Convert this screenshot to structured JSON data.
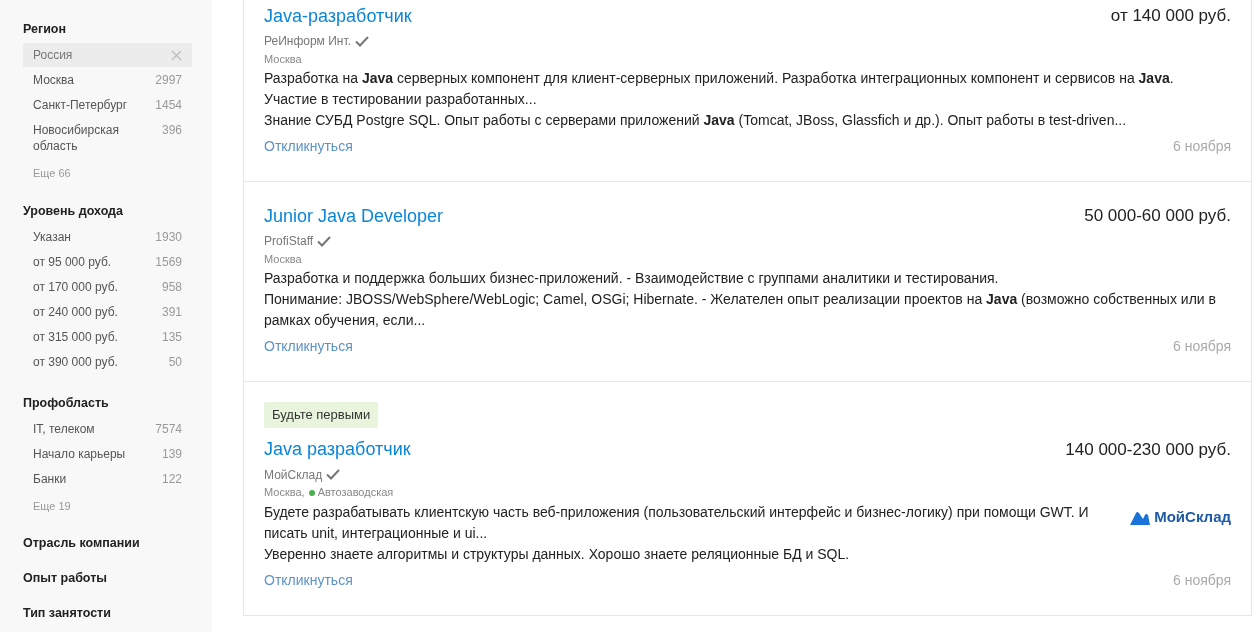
{
  "filters": [
    {
      "title": "Регион",
      "items": [
        {
          "name": "Россия",
          "selected": true
        },
        {
          "name": "Москва",
          "count": "2997",
          "selected": false
        },
        {
          "name": "Санкт-Петербург",
          "count": "1454",
          "selected": false
        },
        {
          "name": "Новосибирская область",
          "count": "396",
          "selected": false
        }
      ],
      "more": "Еще 66"
    },
    {
      "title": "Уровень дохода",
      "items": [
        {
          "name": "Указан",
          "count": "1930",
          "selected": false
        },
        {
          "name": "от 95 000 руб.",
          "count": "1569",
          "selected": false
        },
        {
          "name": "от 170 000 руб.",
          "count": "958",
          "selected": false
        },
        {
          "name": "от 240 000 руб.",
          "count": "391",
          "selected": false
        },
        {
          "name": "от 315 000 руб.",
          "count": "135",
          "selected": false
        },
        {
          "name": "от 390 000 руб.",
          "count": "50",
          "selected": false
        }
      ]
    },
    {
      "title": "Профобласть",
      "items": [
        {
          "name": "IT, телеком",
          "count": "7574",
          "selected": false
        },
        {
          "name": "Начало карьеры",
          "count": "139",
          "selected": false
        },
        {
          "name": "Банки",
          "count": "122",
          "selected": false
        }
      ],
      "more": "Еще 19"
    },
    {
      "title": "Отрасль компании"
    },
    {
      "title": "Опыт работы"
    },
    {
      "title": "Тип занятости"
    }
  ],
  "vacancies": [
    {
      "title": "Java-разработчик",
      "salary": "от 140 000 руб.",
      "company": "РеИнформ Инт.",
      "verified": true,
      "location": "Москва",
      "description": [
        "Разработка на **Java** серверных компонент для клиент-серверных приложений. Разработка интеграционных компонент и сервисов на **Java**. Участие в тестировании разработанных...",
        "Знание СУБД Postgre SQL. Опыт работы с серверами приложений **Java** (Tomcat, JBoss, Glassfich и др.). Опыт работы в test-driven..."
      ],
      "respond": "Откликнуться",
      "date": "6 ноября"
    },
    {
      "title": "Junior Java Developer",
      "salary": "50 000-60 000 руб.",
      "company": "ProfiStaff",
      "verified": true,
      "location": "Москва",
      "description": [
        "Разработка и поддержка больших бизнес-приложений. - Взаимодействие с группами аналитики и тестирования.",
        "Понимание: JBOSS/WebSphere/WebLogic; Camel, OSGi; Hibernate. - Желателен опыт реализации проектов на **Java** (возможно собственных или в рамках обучения, если..."
      ],
      "respond": "Откликнуться",
      "date": "6 ноября"
    },
    {
      "badge": "Будьте первыми",
      "title": "Java разработчик",
      "salary": "140 000-230 000 руб.",
      "company": "МойСклад",
      "verified": true,
      "location": "Москва,",
      "metro": {
        "name": "Автозаводская",
        "color": "#4caf50"
      },
      "description": [
        "Будете разрабатывать клиентскую часть веб-приложения (пользовательский интерфейс и бизнес-логику) при помощи GWT. И писать unit, интеграционные и ui...",
        "Уверенно знаете алгоритмы и структуры данных. Хорошо знаете реляционные БД и SQL."
      ],
      "respond": "Откликнуться",
      "date": "6 ноября",
      "logo": "МойСклад"
    }
  ]
}
